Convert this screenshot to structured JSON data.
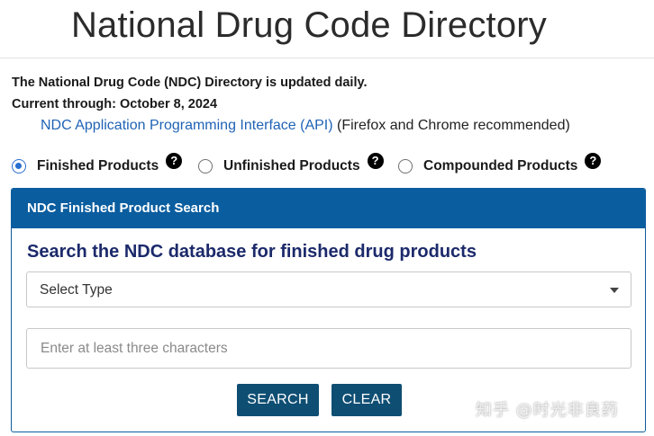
{
  "page": {
    "title": "National Drug Code Directory"
  },
  "info": {
    "updated_line": "The National Drug Code (NDC) Directory is updated daily.",
    "current_through": "Current through: October 8, 2024",
    "api_link": "NDC Application Programming Interface (API)",
    "api_note": " (Firefox and Chrome recommended)"
  },
  "radios": {
    "finished": "Finished Products",
    "unfinished": "Unfinished Products",
    "compounded": "Compounded Products",
    "help_glyph": "?",
    "selected": "Finished Products"
  },
  "panel": {
    "header": "NDC Finished Product Search",
    "heading": "Search the NDC database for finished drug products",
    "select_type": "Select Type",
    "input_placeholder": "Enter at least three characters",
    "search_button": "SEARCH",
    "clear_button": "CLEAR"
  },
  "watermark": "知乎 @时光非良药",
  "colors": {
    "panel_header": "#0a5d9f",
    "button": "#0f4e73",
    "link": "#1f63b6",
    "heading": "#1c2a6b",
    "radio_selected": "#2a6fd0"
  }
}
